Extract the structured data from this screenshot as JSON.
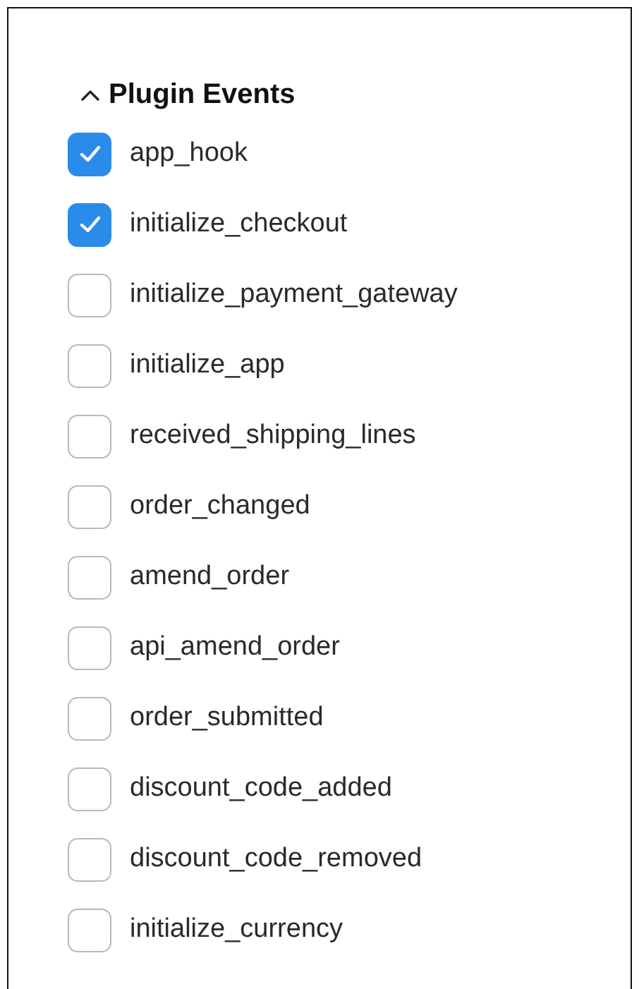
{
  "section": {
    "title": "Plugin Events",
    "expanded": true
  },
  "events": [
    {
      "label": "app_hook",
      "checked": true
    },
    {
      "label": "initialize_checkout",
      "checked": true
    },
    {
      "label": "initialize_payment_gateway",
      "checked": false
    },
    {
      "label": "initialize_app",
      "checked": false
    },
    {
      "label": "received_shipping_lines",
      "checked": false
    },
    {
      "label": "order_changed",
      "checked": false
    },
    {
      "label": "amend_order",
      "checked": false
    },
    {
      "label": "api_amend_order",
      "checked": false
    },
    {
      "label": "order_submitted",
      "checked": false
    },
    {
      "label": "discount_code_added",
      "checked": false
    },
    {
      "label": "discount_code_removed",
      "checked": false
    },
    {
      "label": "initialize_currency",
      "checked": false
    }
  ]
}
